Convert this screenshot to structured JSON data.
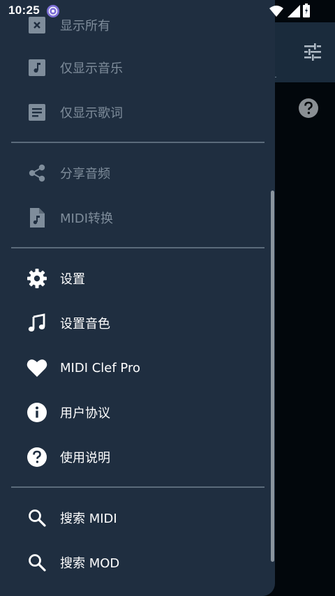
{
  "status_bar": {
    "time": "10:25"
  },
  "drawer": {
    "items_group1": [
      {
        "label": "显示所有",
        "icon": "show-all-icon"
      },
      {
        "label": "仅显示音乐",
        "icon": "music-note-box-icon"
      },
      {
        "label": "仅显示歌词",
        "icon": "lyrics-doc-icon"
      }
    ],
    "items_group2": [
      {
        "label": "分享音频",
        "icon": "share-icon"
      },
      {
        "label": "MIDI转换",
        "icon": "music-file-icon"
      }
    ],
    "items_group3": [
      {
        "label": "设置",
        "icon": "gear-icon"
      },
      {
        "label": "设置音色",
        "icon": "music-note-icon"
      },
      {
        "label": "MIDI Clef Pro",
        "icon": "heart-icon"
      },
      {
        "label": "用户协议",
        "icon": "info-icon"
      },
      {
        "label": "使用说明",
        "icon": "help-icon"
      }
    ],
    "items_group4": [
      {
        "label": "搜索 MIDI",
        "icon": "search-icon"
      },
      {
        "label": "搜索 MOD",
        "icon": "search-icon"
      }
    ]
  },
  "colors": {
    "drawer_bg": "#1f2e40",
    "app_bg": "#02070c",
    "toolbar_bg": "#1a2b3c",
    "disabled_text": "#7f8d9b",
    "divider": "#5b6b7b"
  }
}
